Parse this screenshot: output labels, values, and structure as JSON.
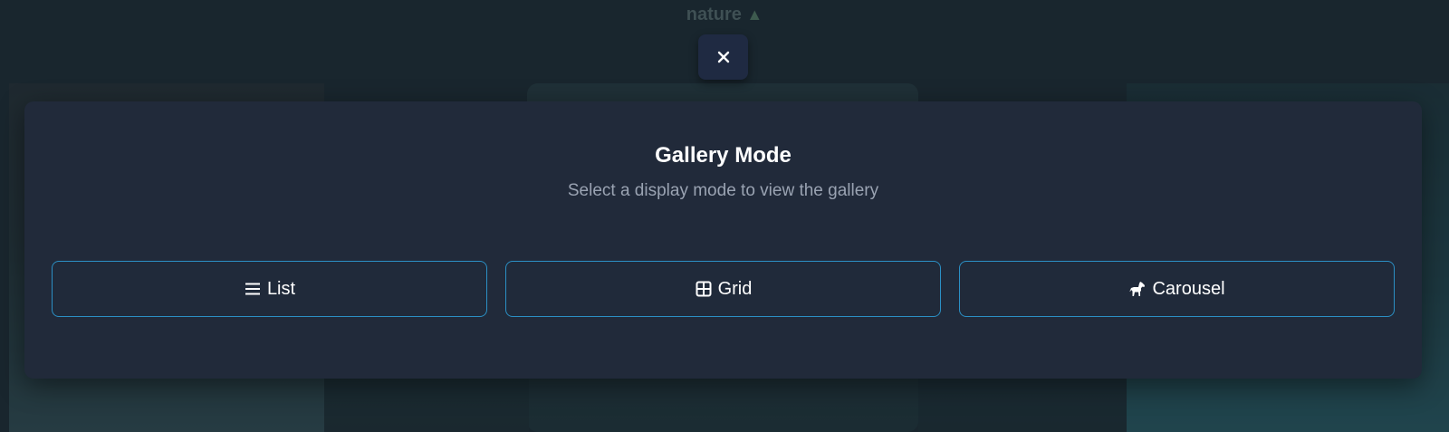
{
  "page": {
    "title": "nature",
    "title_icon": "tree-icon"
  },
  "close_button": {
    "icon": "close-icon"
  },
  "modal": {
    "title": "Gallery Mode",
    "subtitle": "Select a display mode to view the gallery",
    "buttons": [
      {
        "label": "List",
        "icon": "list-icon"
      },
      {
        "label": "Grid",
        "icon": "grid-icon"
      },
      {
        "label": "Carousel",
        "icon": "horse-icon"
      }
    ]
  },
  "colors": {
    "accent_border": "#2b8fc4",
    "modal_bg": "#212a3a",
    "close_bg": "#1f2a42"
  }
}
